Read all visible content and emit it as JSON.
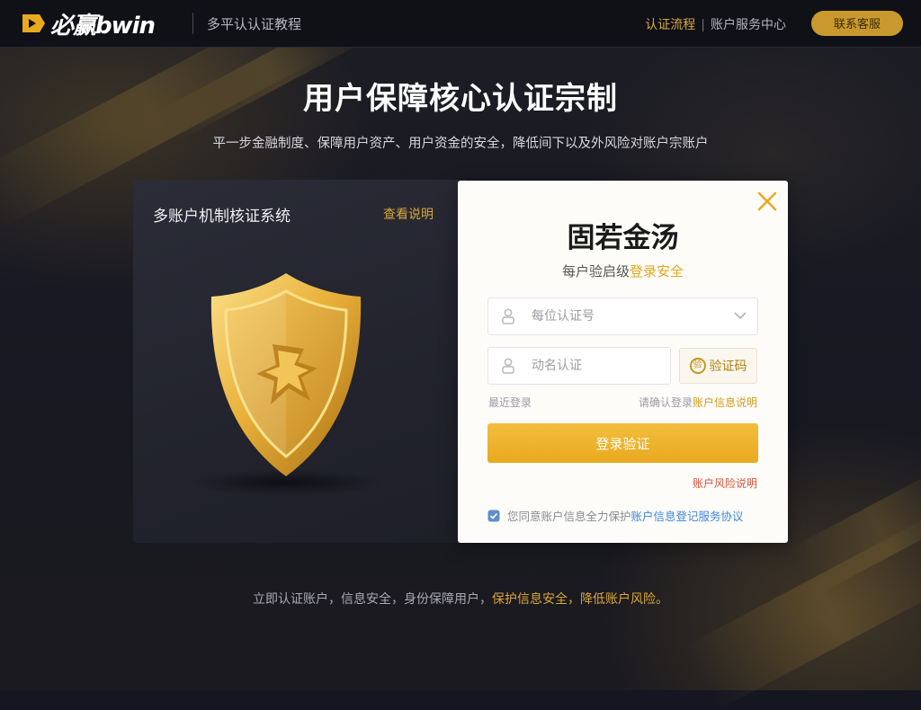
{
  "header": {
    "logo_text": "必赢bwin",
    "site_title": "多平认认证教程",
    "link_1": "认证流程",
    "link_2": "账户服务中心",
    "action_button": "联系客服"
  },
  "hero": {
    "title": "用户保障核心认证宗制",
    "subtitle": "平一步金融制度、保障用户资产、用户资金的安全，降低间下以及外风险对账户宗账户"
  },
  "left_panel": {
    "title": "多账户机制核证系统",
    "link": "查看说明"
  },
  "login_card": {
    "title": "固若金汤",
    "subtitle_prefix": "每户验启级",
    "subtitle_highlight": "登录安全",
    "account_placeholder": "每位认证号",
    "name_placeholder": "动名认证",
    "captcha_label": "验证码",
    "hint_left": "最近登录",
    "hint_right_prefix": "请确认登录",
    "hint_right_highlight": "账户信息说明",
    "submit_label": "登录验证",
    "risk_link": "账户风险说明",
    "footer_prefix": "您同意账户信息全力保护",
    "footer_highlight": "账户信息登记服务协议"
  },
  "footer": {
    "text_prefix": "立即认证账户，信息安全，身份保障用户，",
    "text_highlight": "保护信息安全，降低账户风险。"
  },
  "colors": {
    "accent_gold": "#e9a91e",
    "link_blue": "#3f86d8",
    "warning_red": "#d9533b",
    "background": "#151621"
  },
  "icons": [
    "logo-mark-icon",
    "shield-emblem-icon",
    "close-icon",
    "user-icon",
    "lock-icon",
    "chevron-down-icon",
    "captcha-seal-icon",
    "verified-shield-icon"
  ]
}
